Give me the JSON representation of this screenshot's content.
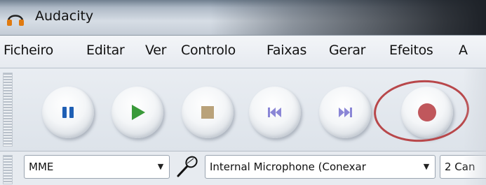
{
  "window": {
    "title": "Audacity",
    "app_icon": "headphones-icon"
  },
  "menu": {
    "items": [
      "Ficheiro",
      "Editar",
      "Ver",
      "Controlo",
      "Faixas",
      "Gerar",
      "Efeitos",
      "A"
    ]
  },
  "transport": {
    "buttons": [
      {
        "name": "pause",
        "icon": "pause-icon",
        "color": "#1f5fb4"
      },
      {
        "name": "play",
        "icon": "play-icon",
        "color": "#3a9a3a"
      },
      {
        "name": "stop",
        "icon": "stop-icon",
        "color": "#b9a27a"
      },
      {
        "name": "skip-to-start",
        "icon": "skip-start-icon",
        "color": "#8a86d6"
      },
      {
        "name": "skip-to-end",
        "icon": "skip-end-icon",
        "color": "#8a86d6"
      },
      {
        "name": "record",
        "icon": "record-icon",
        "color": "#c0575c"
      }
    ],
    "highlight_color": "#b8474a"
  },
  "device": {
    "host": "MME",
    "input_device": "Internal Microphone (Conexar",
    "channels": "2 Can",
    "mic_icon": "microphone-icon"
  }
}
